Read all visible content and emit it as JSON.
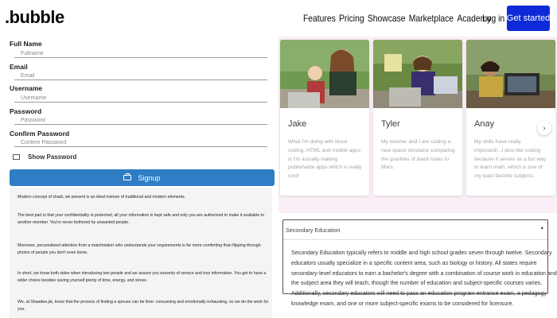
{
  "brand": {
    "logo": ".bubble"
  },
  "nav": {
    "links": [
      "Features",
      "Pricing",
      "Showcase",
      "Marketplace",
      "Academy"
    ],
    "login": "Log in",
    "get_started": "Get started"
  },
  "form": {
    "fields": [
      {
        "label": "Full Name",
        "placeholder": "Fullname"
      },
      {
        "label": "Email",
        "placeholder": "Email"
      },
      {
        "label": "Username",
        "placeholder": "Username"
      },
      {
        "label": "Password",
        "placeholder": "Password"
      },
      {
        "label": "Confirm Password",
        "placeholder": "Confirm Password"
      }
    ],
    "show_password": "Show Password",
    "signup": "Signup"
  },
  "about": {
    "paragraphs": [
      "Modern concept of shadi, we present is an ideal mixture of traditional and modern elements.",
      "The best part is that your confidentiality is protected; all your information is kept safe and only you are authorized to make it available to another member. You're never bothered by unwanted people.",
      "Moreover, personalized attention from a matchmaker who understands your requirements is far more comforting than flipping through photos of people you don't even know.",
      "In short, we know both sides when introducing two people and we assure you sincerity of service and true information. You get to have a wider choice besides saving yourself plenty of time, energy, and stress.",
      "We, at Shaadee.pk, know that the process of finding a spouse can be time- consuming and emotionally exhausting, so we do the work for you."
    ]
  },
  "testimonials": [
    {
      "name": "Jake",
      "text": "What I'm doing with block coding, HTML and mobile apps is I'm actually making publishable apps which is really cool!"
    },
    {
      "name": "Tyler",
      "text": "My teacher and I are coding a new space simulator comparing the gravities of black holes to Mars."
    },
    {
      "name": "Anay",
      "text": "My skills have really improved!...I also like coding because it serves as a fun way to learn math, which is one of my least favorite subjects."
    }
  ],
  "accordion": {
    "title": "Secondary Education",
    "toggle": "▴",
    "body": "Secondary Education typically refers to middle and high school grades seven through twelve. Secondary educators usually specialize in a specific content area, such as biology or history. All states require secondary-level educators to earn a bachelor's degree with a combination of course work in education and the subject area they will teach, though the number of education and subject-specific courses varies. Additionally, secondary educators will need to pass an education program entrance exam, a pedagogy knowledge exam, and one or more subject-specific exams to be considered for licensure."
  },
  "colors": {
    "accent": "#0e2ad8",
    "signup": "#2f7dc4",
    "panel": "#fbeff7"
  },
  "icons": {
    "signup": "briefcase-icon",
    "next": "chevron-right-icon"
  }
}
